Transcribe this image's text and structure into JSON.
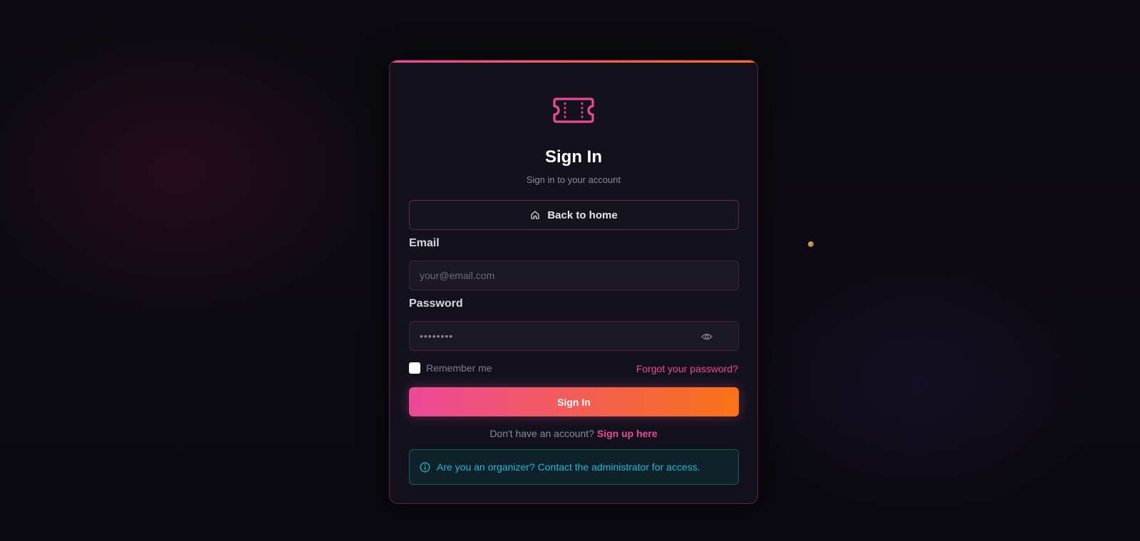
{
  "page": {
    "title": "Sign In",
    "subtitle": "Sign in to your account"
  },
  "logo": {
    "icon": "ticket-icon",
    "color": "#ec4899"
  },
  "back_button": {
    "label": "Back to home",
    "icon": "home-icon"
  },
  "email": {
    "label": "Email",
    "placeholder": "your@email.com",
    "value": ""
  },
  "password": {
    "label": "Password",
    "masked_value": "••••••••",
    "icon": "eye-icon"
  },
  "remember": {
    "label": "Remember me",
    "checked": false
  },
  "forgot_link": "Forgot your password?",
  "submit": {
    "label": "Sign In"
  },
  "signup": {
    "prompt": "Don't have an account?",
    "link": "Sign up here"
  },
  "info": {
    "icon": "info-icon",
    "text": "Are you an organizer? Contact the administrator for access."
  },
  "colors": {
    "accent_pink": "#ec4899",
    "accent_orange": "#f97316",
    "info_cyan": "#22b8d8",
    "card_bg": "#13121c",
    "page_bg": "#0b0a10"
  }
}
